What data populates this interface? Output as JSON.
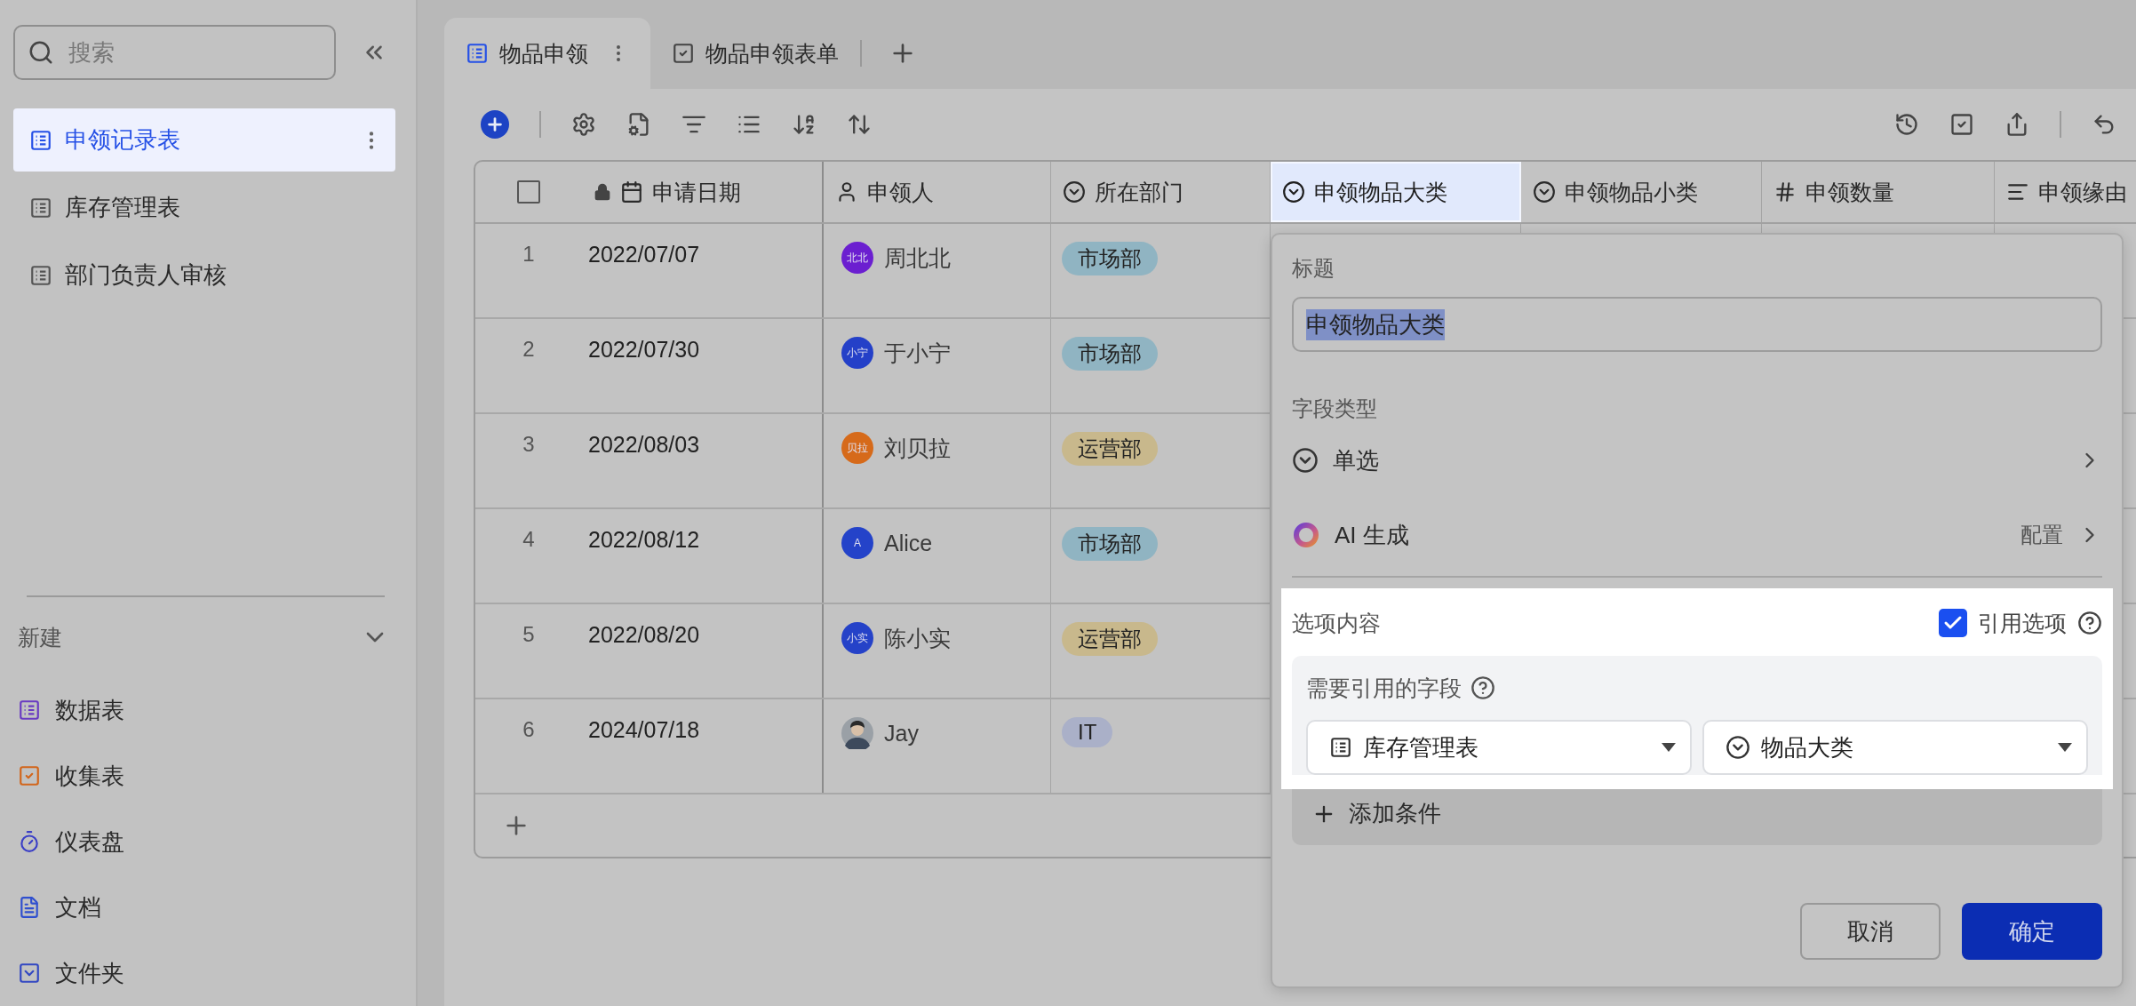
{
  "sidebar": {
    "search": {
      "placeholder": "搜索"
    },
    "tables": [
      {
        "label": "申领记录表",
        "selected": true
      },
      {
        "label": "库存管理表",
        "selected": false
      },
      {
        "label": "部门负责人审核",
        "selected": false
      }
    ],
    "new_section": {
      "label": "新建",
      "expanded": true,
      "items": [
        {
          "label": "数据表",
          "color": "#6a3bc2"
        },
        {
          "label": "收集表",
          "color": "#d2661c"
        },
        {
          "label": "仪表盘",
          "color": "#3b3fc6"
        },
        {
          "label": "文档",
          "color": "#2f4fcf"
        },
        {
          "label": "文件夹",
          "color": "#3348c2"
        }
      ]
    }
  },
  "tabs": [
    {
      "label": "物品申领",
      "kind": "grid",
      "selected": true
    },
    {
      "label": "物品申领表单",
      "kind": "form",
      "selected": false
    }
  ],
  "table": {
    "select_all_checked": false,
    "columns": [
      {
        "label": "申请日期",
        "kind": "date",
        "locked": true,
        "selected": false
      },
      {
        "label": "申领人",
        "kind": "person",
        "locked": false,
        "selected": false
      },
      {
        "label": "所在部门",
        "kind": "select",
        "locked": false,
        "selected": false
      },
      {
        "label": "申领物品大类",
        "kind": "select",
        "locked": false,
        "selected": true
      },
      {
        "label": "申领物品小类",
        "kind": "select",
        "locked": false,
        "selected": false
      },
      {
        "label": "申领数量",
        "kind": "number",
        "locked": false,
        "selected": false
      },
      {
        "label": "申领缘由",
        "kind": "text",
        "locked": false,
        "selected": false
      }
    ],
    "rows": [
      {
        "number": "1",
        "date": "2022/07/07",
        "person": {
          "name": "周北北",
          "avatar": {
            "kind": "initials",
            "text": "北北",
            "color": "#6b1fd0"
          }
        },
        "department": {
          "label": "市场部",
          "color": "#90b4c2"
        }
      },
      {
        "number": "2",
        "date": "2022/07/30",
        "person": {
          "name": "于小宁",
          "avatar": {
            "kind": "initials",
            "text": "小宁",
            "color": "#2440c8"
          }
        },
        "department": {
          "label": "市场部",
          "color": "#90b4c2"
        }
      },
      {
        "number": "3",
        "date": "2022/08/03",
        "person": {
          "name": "刘贝拉",
          "avatar": {
            "kind": "initials",
            "text": "贝拉",
            "color": "#d66a1a"
          }
        },
        "department": {
          "label": "运营部",
          "color": "#c8b88c"
        }
      },
      {
        "number": "4",
        "date": "2022/08/12",
        "person": {
          "name": "Alice",
          "avatar": {
            "kind": "initials",
            "text": "A",
            "color": "#2443c9"
          }
        },
        "department": {
          "label": "市场部",
          "color": "#90b4c2"
        }
      },
      {
        "number": "5",
        "date": "2022/08/20",
        "person": {
          "name": "陈小实",
          "avatar": {
            "kind": "initials",
            "text": "小实",
            "color": "#2542c8"
          }
        },
        "department": {
          "label": "运营部",
          "color": "#c8b88c"
        }
      },
      {
        "number": "6",
        "date": "2024/07/18",
        "person": {
          "name": "Jay"
        },
        "department": {
          "label": "IT",
          "color": "#aab0c8"
        }
      }
    ]
  },
  "field_editor": {
    "title_label": "标题",
    "title_value": "申领物品大类",
    "title_text_selected": true,
    "type_label": "字段类型",
    "type": "单选",
    "ai_label": "AI 生成",
    "ai_config": "配置",
    "options_label": "选项内容",
    "reference_checked": true,
    "reference_label": "引用选项",
    "ref_field_label": "需要引用的字段",
    "ref_table": "库存管理表",
    "ref_field": "物品大类",
    "add_condition": "添加条件",
    "buttons": [
      {
        "label": "取消",
        "kind": "secondary"
      },
      {
        "label": "确定",
        "kind": "primary"
      }
    ]
  }
}
